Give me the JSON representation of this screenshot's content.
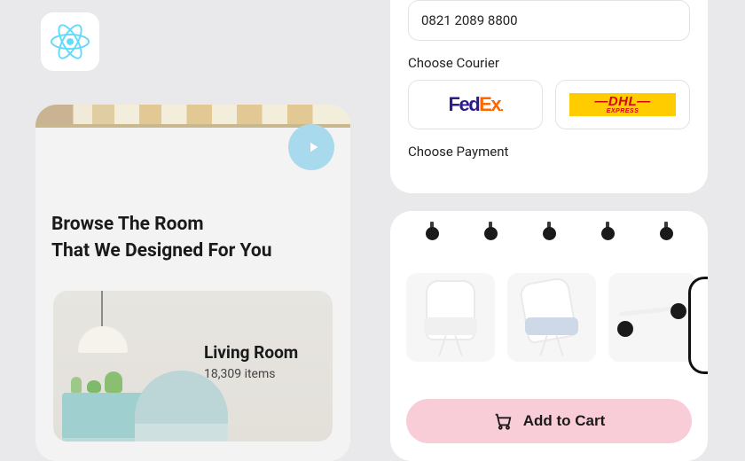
{
  "app_icon": "react-logo",
  "left": {
    "headline_line1": "Browse The Room",
    "headline_line2": "That We Designed For You",
    "room": {
      "title": "Living Room",
      "count_text": "18,309 items"
    }
  },
  "checkout": {
    "phone_value": "0821 2089 8800",
    "courier_label": "Choose Courier",
    "payment_label": "Choose Payment",
    "couriers": {
      "fedex": {
        "prefix": "Fed",
        "suffix": "Ex",
        "dot": "."
      },
      "dhl": {
        "main": "—DHL—",
        "sub": "EXPRESS"
      }
    }
  },
  "product": {
    "cart_label": "Add to Cart"
  }
}
